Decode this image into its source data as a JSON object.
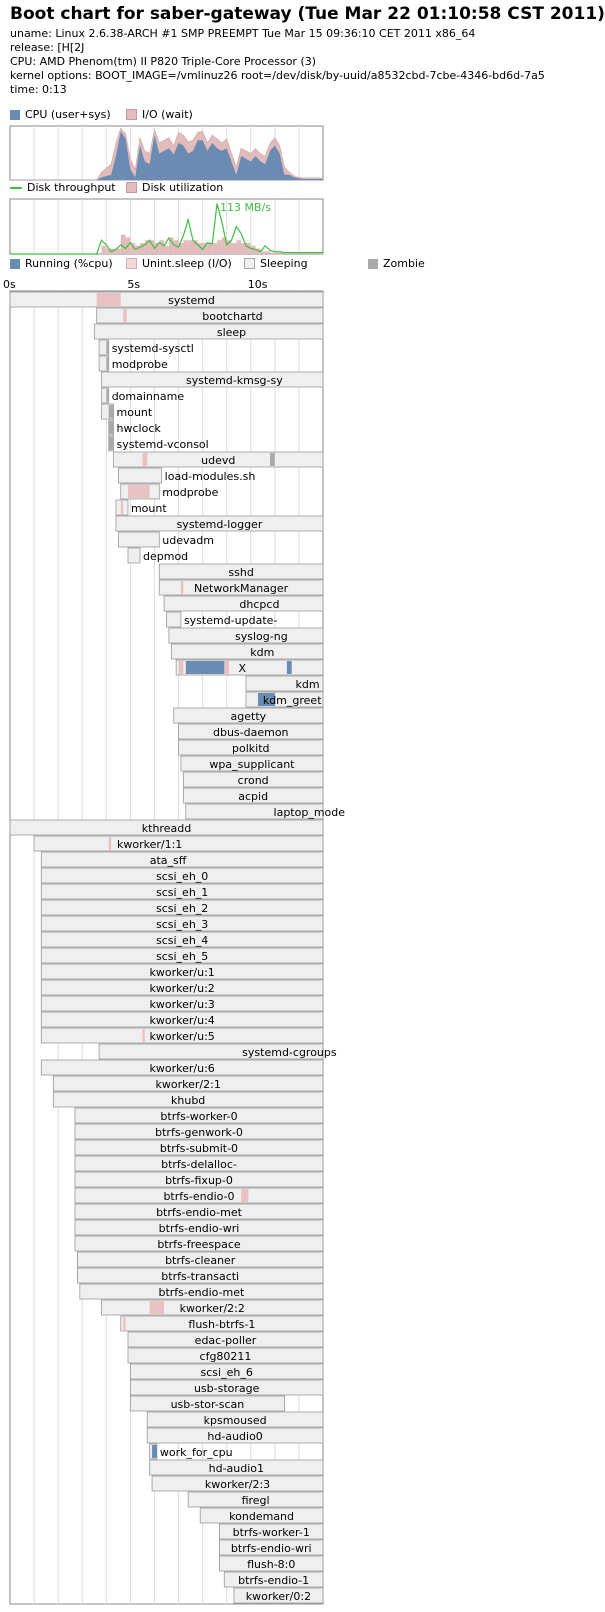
{
  "header": {
    "title": "Boot chart for saber-gateway (Tue Mar 22 01:10:58 CST 2011)",
    "uname": "uname: Linux 2.6.38-ARCH #1 SMP PREEMPT Tue Mar 15 09:36:10 CET 2011 x86_64",
    "release": "release: [H[2J",
    "cpu": "CPU: AMD Phenom(tm) II P820 Triple-Core Processor (3)",
    "kernel": "kernel options: BOOT_IMAGE=/vmlinuz26 root=/dev/disk/by-uuid/a8532cbd-7cbe-4346-bd6d-7a5",
    "time": "time: 0:13"
  },
  "legend": {
    "cpu": "CPU (user+sys)",
    "io": "I/O (wait)",
    "disk_throughput": "Disk throughput",
    "disk_util": "Disk utilization",
    "running": "Running (%cpu)",
    "unint": "Unint.sleep (I/O)",
    "sleeping": "Sleeping",
    "zombie": "Zombie"
  },
  "colors": {
    "cpu": "#6a8bb2",
    "io": "#e2bcbc",
    "disk_line": "#3fbf3f",
    "running": "#6a8bb2",
    "unint": "#c76b6b",
    "sleeping": "#efefef",
    "zombie": "#aaaaaa",
    "border": "#888888",
    "grid": "#dddddd"
  },
  "time_axis": {
    "ticks": [
      0,
      5,
      10
    ],
    "labels": [
      "0s",
      "5s",
      "10s"
    ],
    "max_seconds": 13
  },
  "chart_data": [
    {
      "type": "area",
      "name": "cpu",
      "x": [
        0,
        3.6,
        3.8,
        4.2,
        4.4,
        4.6,
        4.8,
        5.0,
        5.2,
        5.4,
        5.6,
        5.8,
        6.0,
        6.2,
        6.4,
        6.6,
        6.8,
        7.0,
        7.2,
        7.4,
        7.6,
        7.8,
        8.0,
        8.2,
        8.4,
        8.6,
        8.8,
        9.0,
        9.2,
        9.4,
        9.6,
        9.8,
        10.0,
        10.2,
        10.4,
        10.6,
        10.8,
        11.0,
        11.2,
        11.4,
        11.6,
        11.8,
        12.0,
        12.2,
        12.4,
        12.6,
        12.8,
        13.0
      ],
      "series": [
        {
          "name": "CPU (user+sys)",
          "values": [
            0,
            0,
            5,
            10,
            45,
            92,
            78,
            20,
            5,
            65,
            35,
            30,
            85,
            50,
            55,
            60,
            48,
            70,
            65,
            50,
            55,
            75,
            75,
            55,
            70,
            60,
            55,
            60,
            35,
            10,
            45,
            40,
            35,
            45,
            35,
            30,
            55,
            65,
            50,
            10,
            10,
            5,
            3,
            2,
            2,
            2,
            2,
            2
          ]
        },
        {
          "name": "I/O (wait)",
          "values": [
            0,
            0,
            15,
            30,
            70,
            98,
            88,
            40,
            20,
            80,
            55,
            50,
            95,
            70,
            75,
            80,
            65,
            90,
            85,
            72,
            75,
            90,
            92,
            70,
            85,
            78,
            70,
            78,
            50,
            25,
            60,
            55,
            50,
            60,
            50,
            45,
            70,
            80,
            65,
            25,
            15,
            8,
            5,
            4,
            4,
            4,
            4,
            4
          ]
        }
      ]
    },
    {
      "type": "line",
      "name": "disk",
      "annotation": "113 MB/s",
      "x": [
        0,
        3.6,
        3.8,
        4.0,
        4.2,
        4.4,
        4.6,
        4.8,
        5.0,
        5.2,
        5.4,
        5.6,
        5.8,
        6.0,
        6.2,
        6.4,
        6.6,
        6.8,
        7.0,
        7.2,
        7.4,
        7.6,
        7.8,
        8.0,
        8.2,
        8.4,
        8.6,
        8.8,
        9.0,
        9.2,
        9.4,
        9.6,
        9.8,
        10.0,
        10.2,
        10.4,
        10.6,
        10.8,
        11.0,
        11.2,
        11.4,
        11.6,
        11.8,
        12.0,
        12.2,
        12.4,
        12.6,
        12.8,
        13.0
      ],
      "series": [
        {
          "name": "Disk throughput",
          "values": [
            0,
            0,
            30,
            20,
            5,
            10,
            20,
            12,
            25,
            10,
            15,
            20,
            30,
            12,
            25,
            18,
            35,
            20,
            15,
            40,
            75,
            30,
            20,
            10,
            25,
            22,
            110,
            70,
            20,
            30,
            60,
            45,
            18,
            12,
            10,
            5,
            18,
            8,
            5,
            5,
            3,
            3,
            3,
            3,
            3,
            3,
            3,
            3,
            3
          ]
        },
        {
          "name": "Disk utilization",
          "values": [
            0,
            0,
            15,
            10,
            10,
            10,
            35,
            30,
            20,
            15,
            20,
            25,
            25,
            20,
            25,
            15,
            30,
            25,
            20,
            25,
            25,
            25,
            20,
            20,
            20,
            20,
            25,
            30,
            25,
            20,
            25,
            20,
            20,
            15,
            10,
            5,
            5,
            3,
            3,
            3,
            3,
            3,
            3,
            3,
            3,
            3,
            3,
            3,
            3
          ]
        }
      ]
    }
  ],
  "processes": [
    {
      "name": "systemd",
      "s": 0,
      "e": 13,
      "lbl": 0.58,
      "unint": [
        [
          3.6,
          4.6
        ]
      ],
      "run": [],
      "zombie": []
    },
    {
      "name": "bootchartd",
      "s": 3.6,
      "e": 13,
      "lbl": 0.6,
      "unint": [
        [
          4.7,
          4.85
        ]
      ],
      "run": [],
      "zombie": []
    },
    {
      "name": "sleep",
      "s": 3.5,
      "e": 13,
      "lbl": 0.6,
      "unint": [],
      "run": [],
      "zombie": []
    },
    {
      "name": "systemd-sysctl",
      "s": 3.7,
      "e": 4.1,
      "lbl": -1,
      "unint": [],
      "run": [],
      "zombie": [
        [
          4.0,
          4.1
        ]
      ]
    },
    {
      "name": "modprobe",
      "s": 3.7,
      "e": 4.1,
      "lbl": -1,
      "unint": [],
      "run": [],
      "zombie": [
        [
          4.0,
          4.1
        ]
      ]
    },
    {
      "name": "systemd-kmsg-sy",
      "s": 3.8,
      "e": 13,
      "lbl": 0.6,
      "unint": [],
      "run": [],
      "zombie": []
    },
    {
      "name": "domainname",
      "s": 3.8,
      "e": 4.1,
      "lbl": -1,
      "unint": [],
      "run": [],
      "zombie": [
        [
          4.0,
          4.1
        ]
      ]
    },
    {
      "name": "mount",
      "s": 3.8,
      "e": 4.3,
      "lbl": -1,
      "unint": [],
      "run": [],
      "zombie": [
        [
          4.1,
          4.3
        ]
      ]
    },
    {
      "name": "hwclock",
      "s": 4.1,
      "e": 4.3,
      "lbl": -1,
      "unint": [],
      "run": [],
      "zombie": [
        [
          4.1,
          4.3
        ]
      ]
    },
    {
      "name": "systemd-vconsol",
      "s": 4.1,
      "e": 4.3,
      "lbl": -1,
      "unint": [],
      "run": [],
      "zombie": [
        [
          4.1,
          4.3
        ]
      ]
    },
    {
      "name": "udevd",
      "s": 4.3,
      "e": 13,
      "lbl": 0.5,
      "unint": [
        [
          5.5,
          5.7
        ]
      ],
      "run": [],
      "zombie": [
        [
          10.8,
          11.0
        ]
      ]
    },
    {
      "name": "load-modules.sh",
      "s": 4.5,
      "e": 6.3,
      "lbl": -1,
      "unint": [],
      "run": [],
      "zombie": []
    },
    {
      "name": "modprobe",
      "s": 4.6,
      "e": 6.2,
      "lbl": -1,
      "unint": [
        [
          4.9,
          5.8
        ]
      ],
      "run": [],
      "zombie": []
    },
    {
      "name": "mount",
      "s": 4.4,
      "e": 4.9,
      "lbl": -1,
      "unint": [
        [
          4.6,
          4.7
        ]
      ],
      "run": [],
      "zombie": []
    },
    {
      "name": "systemd-logger",
      "s": 4.4,
      "e": 13,
      "lbl": 0.5,
      "unint": [],
      "run": [],
      "zombie": []
    },
    {
      "name": "udevadm",
      "s": 4.5,
      "e": 6.2,
      "lbl": -1,
      "unint": [],
      "run": [],
      "zombie": []
    },
    {
      "name": "depmod",
      "s": 4.9,
      "e": 5.4,
      "lbl": -1,
      "unint": [],
      "run": [],
      "zombie": []
    },
    {
      "name": "sshd",
      "s": 6.2,
      "e": 13,
      "lbl": 0.5,
      "unint": [],
      "run": [],
      "zombie": []
    },
    {
      "name": "NetworkManager",
      "s": 6.2,
      "e": 13,
      "lbl": 0.5,
      "unint": [
        [
          7.1,
          7.2
        ]
      ],
      "run": [],
      "zombie": []
    },
    {
      "name": "dhcpcd",
      "s": 6.4,
      "e": 13,
      "lbl": 0.6,
      "unint": [],
      "run": [],
      "zombie": []
    },
    {
      "name": "systemd-update-",
      "s": 6.5,
      "e": 7.1,
      "lbl": -1,
      "unint": [],
      "run": [],
      "zombie": []
    },
    {
      "name": "syslog-ng",
      "s": 6.6,
      "e": 13,
      "lbl": 0.6,
      "unint": [],
      "run": [],
      "zombie": []
    },
    {
      "name": "kdm",
      "s": 6.7,
      "e": 13,
      "lbl": 0.6,
      "unint": [],
      "run": [],
      "zombie": []
    },
    {
      "name": "X",
      "s": 6.9,
      "e": 13,
      "lbl": 0.45,
      "unint": [
        [
          7.0,
          7.2
        ],
        [
          8.9,
          9.1
        ]
      ],
      "run": [
        [
          7.3,
          8.9
        ],
        [
          11.5,
          11.7
        ]
      ],
      "zombie": []
    },
    {
      "name": "kdm",
      "s": 9.8,
      "e": 13,
      "lbl": 0.8,
      "unint": [],
      "run": [],
      "zombie": []
    },
    {
      "name": "kdm_greet",
      "s": 9.8,
      "e": 13,
      "lbl": 0.6,
      "unint": [],
      "run": [
        [
          10.3,
          11.0
        ]
      ],
      "zombie": []
    },
    {
      "name": "agetty",
      "s": 6.8,
      "e": 13,
      "lbl": 0.5,
      "unint": [],
      "run": [],
      "zombie": []
    },
    {
      "name": "dbus-daemon",
      "s": 7.0,
      "e": 13,
      "lbl": 0.5,
      "unint": [],
      "run": [],
      "zombie": []
    },
    {
      "name": "polkitd",
      "s": 7.0,
      "e": 13,
      "lbl": 0.5,
      "unint": [],
      "run": [],
      "zombie": []
    },
    {
      "name": "wpa_supplicant",
      "s": 7.1,
      "e": 13,
      "lbl": 0.5,
      "unint": [],
      "run": [],
      "zombie": []
    },
    {
      "name": "crond",
      "s": 7.2,
      "e": 13,
      "lbl": 0.5,
      "unint": [],
      "run": [],
      "zombie": []
    },
    {
      "name": "acpid",
      "s": 7.2,
      "e": 13,
      "lbl": 0.5,
      "unint": [],
      "run": [],
      "zombie": []
    },
    {
      "name": "laptop_mode",
      "s": 7.3,
      "e": 13,
      "lbl": 0.9,
      "unint": [],
      "run": [],
      "zombie": []
    },
    {
      "name": "kthreadd",
      "s": 0,
      "e": 13,
      "lbl": 0.5,
      "unint": [],
      "run": [],
      "zombie": []
    },
    {
      "name": "kworker/1:1",
      "s": 1.0,
      "e": 13,
      "lbl": 0.4,
      "unint": [
        [
          4.1,
          4.2
        ]
      ],
      "run": [],
      "zombie": []
    },
    {
      "name": "ata_sff",
      "s": 1.3,
      "e": 13,
      "lbl": 0.45,
      "unint": [],
      "run": [],
      "zombie": []
    },
    {
      "name": "scsi_eh_0",
      "s": 1.3,
      "e": 13,
      "lbl": 0.5,
      "unint": [],
      "run": [],
      "zombie": []
    },
    {
      "name": "scsi_eh_1",
      "s": 1.3,
      "e": 13,
      "lbl": 0.5,
      "unint": [],
      "run": [],
      "zombie": []
    },
    {
      "name": "scsi_eh_2",
      "s": 1.3,
      "e": 13,
      "lbl": 0.5,
      "unint": [],
      "run": [],
      "zombie": []
    },
    {
      "name": "scsi_eh_3",
      "s": 1.3,
      "e": 13,
      "lbl": 0.5,
      "unint": [],
      "run": [],
      "zombie": []
    },
    {
      "name": "scsi_eh_4",
      "s": 1.3,
      "e": 13,
      "lbl": 0.5,
      "unint": [],
      "run": [],
      "zombie": []
    },
    {
      "name": "scsi_eh_5",
      "s": 1.3,
      "e": 13,
      "lbl": 0.5,
      "unint": [],
      "run": [],
      "zombie": []
    },
    {
      "name": "kworker/u:1",
      "s": 1.3,
      "e": 13,
      "lbl": 0.5,
      "unint": [],
      "run": [],
      "zombie": []
    },
    {
      "name": "kworker/u:2",
      "s": 1.3,
      "e": 13,
      "lbl": 0.5,
      "unint": [],
      "run": [],
      "zombie": []
    },
    {
      "name": "kworker/u:3",
      "s": 1.3,
      "e": 13,
      "lbl": 0.5,
      "unint": [],
      "run": [],
      "zombie": []
    },
    {
      "name": "kworker/u:4",
      "s": 1.3,
      "e": 13,
      "lbl": 0.5,
      "unint": [],
      "run": [],
      "zombie": []
    },
    {
      "name": "kworker/u:5",
      "s": 1.3,
      "e": 13,
      "lbl": 0.5,
      "unint": [
        [
          5.5,
          5.6
        ]
      ],
      "run": [],
      "zombie": []
    },
    {
      "name": "systemd-cgroups",
      "s": 3.7,
      "e": 13,
      "lbl": 0.85,
      "unint": [],
      "run": [],
      "zombie": []
    },
    {
      "name": "kworker/u:6",
      "s": 1.3,
      "e": 13,
      "lbl": 0.5,
      "unint": [],
      "run": [],
      "zombie": []
    },
    {
      "name": "kworker/2:1",
      "s": 1.8,
      "e": 13,
      "lbl": 0.5,
      "unint": [],
      "run": [],
      "zombie": []
    },
    {
      "name": "khubd",
      "s": 1.8,
      "e": 13,
      "lbl": 0.5,
      "unint": [],
      "run": [],
      "zombie": []
    },
    {
      "name": "btrfs-worker-0",
      "s": 2.7,
      "e": 13,
      "lbl": 0.5,
      "unint": [],
      "run": [],
      "zombie": []
    },
    {
      "name": "btrfs-genwork-0",
      "s": 2.7,
      "e": 13,
      "lbl": 0.5,
      "unint": [],
      "run": [],
      "zombie": []
    },
    {
      "name": "btrfs-submit-0",
      "s": 2.7,
      "e": 13,
      "lbl": 0.5,
      "unint": [],
      "run": [],
      "zombie": []
    },
    {
      "name": "btrfs-delalloc-",
      "s": 2.7,
      "e": 13,
      "lbl": 0.5,
      "unint": [],
      "run": [],
      "zombie": []
    },
    {
      "name": "btrfs-fixup-0",
      "s": 2.7,
      "e": 13,
      "lbl": 0.5,
      "unint": [],
      "run": [],
      "zombie": []
    },
    {
      "name": "btrfs-endio-0",
      "s": 2.7,
      "e": 13,
      "lbl": 0.5,
      "unint": [
        [
          9.6,
          9.9
        ]
      ],
      "run": [],
      "zombie": []
    },
    {
      "name": "btrfs-endio-met",
      "s": 2.7,
      "e": 13,
      "lbl": 0.5,
      "unint": [],
      "run": [],
      "zombie": []
    },
    {
      "name": "btrfs-endio-wri",
      "s": 2.7,
      "e": 13,
      "lbl": 0.5,
      "unint": [],
      "run": [],
      "zombie": []
    },
    {
      "name": "btrfs-freespace",
      "s": 2.7,
      "e": 13,
      "lbl": 0.5,
      "unint": [],
      "run": [],
      "zombie": []
    },
    {
      "name": "btrfs-cleaner",
      "s": 2.8,
      "e": 13,
      "lbl": 0.5,
      "unint": [],
      "run": [],
      "zombie": []
    },
    {
      "name": "btrfs-transacti",
      "s": 2.8,
      "e": 13,
      "lbl": 0.5,
      "unint": [],
      "run": [],
      "zombie": []
    },
    {
      "name": "btrfs-endio-met",
      "s": 2.9,
      "e": 13,
      "lbl": 0.5,
      "unint": [],
      "run": [],
      "zombie": []
    },
    {
      "name": "kworker/2:2",
      "s": 3.8,
      "e": 13,
      "lbl": 0.5,
      "unint": [
        [
          5.8,
          6.4
        ]
      ],
      "run": [],
      "zombie": []
    },
    {
      "name": "flush-btrfs-1",
      "s": 4.6,
      "e": 13,
      "lbl": 0.5,
      "unint": [
        [
          4.7,
          4.8
        ]
      ],
      "run": [],
      "zombie": []
    },
    {
      "name": "edac-poller",
      "s": 4.9,
      "e": 13,
      "lbl": 0.5,
      "unint": [],
      "run": [],
      "zombie": []
    },
    {
      "name": "cfg80211",
      "s": 4.9,
      "e": 13,
      "lbl": 0.5,
      "unint": [],
      "run": [],
      "zombie": []
    },
    {
      "name": "scsi_eh_6",
      "s": 5.0,
      "e": 13,
      "lbl": 0.5,
      "unint": [],
      "run": [],
      "zombie": []
    },
    {
      "name": "usb-storage",
      "s": 5.0,
      "e": 13,
      "lbl": 0.5,
      "unint": [],
      "run": [],
      "zombie": []
    },
    {
      "name": "usb-stor-scan",
      "s": 5.0,
      "e": 11.4,
      "lbl": 0.5,
      "unint": [],
      "run": [],
      "zombie": []
    },
    {
      "name": "kpsmoused",
      "s": 5.7,
      "e": 13,
      "lbl": 0.5,
      "unint": [],
      "run": [],
      "zombie": []
    },
    {
      "name": "hd-audio0",
      "s": 5.7,
      "e": 13,
      "lbl": 0.5,
      "unint": [],
      "run": [],
      "zombie": []
    },
    {
      "name": "work_for_cpu",
      "s": 5.8,
      "e": 6.1,
      "lbl": -1,
      "unint": [],
      "run": [
        [
          5.9,
          6.1
        ]
      ],
      "zombie": []
    },
    {
      "name": "hd-audio1",
      "s": 5.8,
      "e": 13,
      "lbl": 0.5,
      "unint": [],
      "run": [],
      "zombie": []
    },
    {
      "name": "kworker/2:3",
      "s": 5.9,
      "e": 13,
      "lbl": 0.5,
      "unint": [],
      "run": [],
      "zombie": []
    },
    {
      "name": "firegl",
      "s": 7.4,
      "e": 13,
      "lbl": 0.5,
      "unint": [],
      "run": [],
      "zombie": []
    },
    {
      "name": "kondemand",
      "s": 7.9,
      "e": 13,
      "lbl": 0.5,
      "unint": [],
      "run": [],
      "zombie": []
    },
    {
      "name": "btrfs-worker-1",
      "s": 8.7,
      "e": 13,
      "lbl": 0.5,
      "unint": [],
      "run": [],
      "zombie": []
    },
    {
      "name": "btrfs-endio-wri",
      "s": 8.7,
      "e": 13,
      "lbl": 0.5,
      "unint": [],
      "run": [],
      "zombie": []
    },
    {
      "name": "flush-8:0",
      "s": 8.7,
      "e": 13,
      "lbl": 0.5,
      "unint": [],
      "run": [],
      "zombie": []
    },
    {
      "name": "btrfs-endio-1",
      "s": 8.9,
      "e": 13,
      "lbl": 0.5,
      "unint": [],
      "run": [],
      "zombie": []
    },
    {
      "name": "kworker/0:2",
      "s": 9.3,
      "e": 13,
      "lbl": 0.5,
      "unint": [],
      "run": [],
      "zombie": []
    }
  ]
}
